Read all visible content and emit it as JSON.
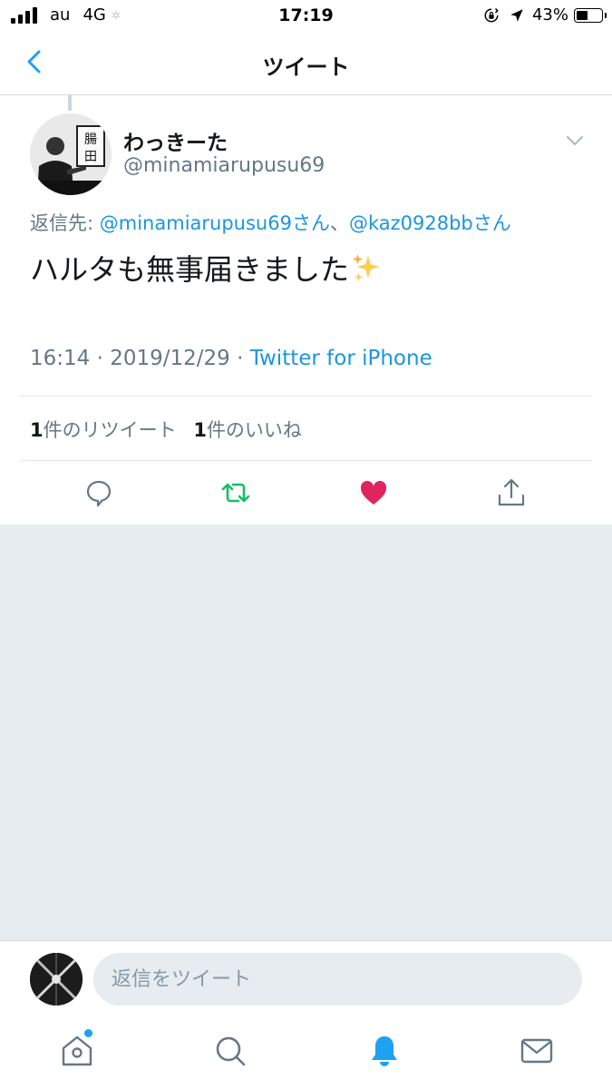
{
  "status_bar": {
    "carrier": "au",
    "network": "4G",
    "time": "17:19",
    "battery": "43%",
    "icons": [
      "signal-icon",
      "orientation-lock-icon",
      "location-icon",
      "battery-icon"
    ]
  },
  "nav": {
    "title": "ツイート",
    "back_icon": "chevron-left-icon"
  },
  "tweet": {
    "display_name": "わっきーた",
    "handle": "@minamiarupusu69",
    "reply_label": "返信先: ",
    "reply_mentions": [
      "@minamiarupusu69さん",
      "@kaz0928bbさん"
    ],
    "reply_separator": "、",
    "text": "ハルタも無事届きました",
    "emoji": "sparkles-icon",
    "time": "16:14",
    "date": "2019/12/29",
    "dot": "·",
    "source": "Twitter for iPhone",
    "retweet_count": "1",
    "retweet_label": "件のリツイート",
    "like_count": "1",
    "like_label": "件のいいね",
    "liked": true
  },
  "colors": {
    "accent": "#1da1f2",
    "link": "#1b95e0",
    "retweet_green": "#17bf63",
    "like_red": "#e0245e",
    "muted": "#657786",
    "background_gray": "#e6ecf0"
  },
  "composer": {
    "placeholder": "返信をツイート"
  },
  "tabbar": {
    "items": [
      "home-icon",
      "search-icon",
      "notifications-icon",
      "messages-icon"
    ],
    "active": "notifications-icon"
  }
}
